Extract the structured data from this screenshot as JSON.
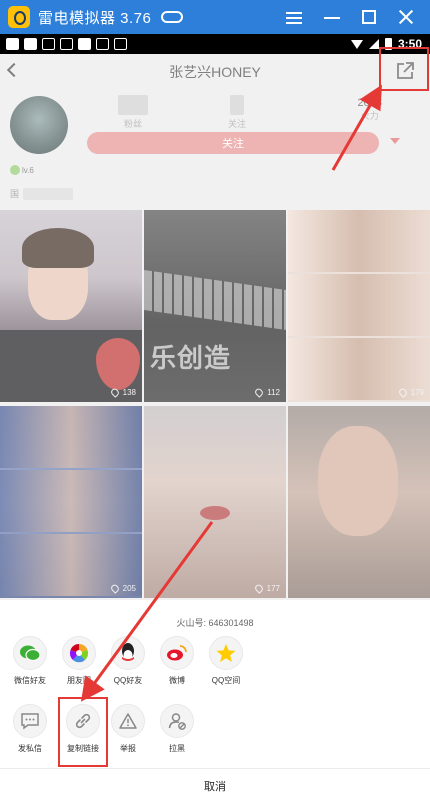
{
  "emulator": {
    "title": "雷电模拟器 3.76"
  },
  "status_bar": {
    "time": "3:50"
  },
  "header": {
    "title": "张艺兴HONEY"
  },
  "profile": {
    "stats": [
      {
        "label": "粉丝"
      },
      {
        "label": "关注"
      },
      {
        "value": "2018",
        "label": "火力"
      }
    ],
    "follow_label": "关注",
    "level": "lv.6",
    "bio_prefix": "国"
  },
  "grid": {
    "tiles": [
      {
        "likes": "138",
        "overlay": ""
      },
      {
        "likes": "112",
        "overlay": "乐创造"
      },
      {
        "likes": "179",
        "overlay": ""
      },
      {
        "likes": "205",
        "overlay": ""
      },
      {
        "likes": "177",
        "overlay": ""
      },
      {
        "likes": "",
        "overlay": ""
      }
    ]
  },
  "share_sheet": {
    "account_id": "火山号: 646301498",
    "row1": [
      {
        "label": "微信好友",
        "icon": "wechat-icon"
      },
      {
        "label": "朋友圈",
        "icon": "moments-icon"
      },
      {
        "label": "QQ好友",
        "icon": "qq-icon"
      },
      {
        "label": "微博",
        "icon": "weibo-icon"
      },
      {
        "label": "QQ空间",
        "icon": "qzone-icon"
      }
    ],
    "row2": [
      {
        "label": "发私信",
        "icon": "message-icon"
      },
      {
        "label": "复制链接",
        "icon": "link-icon"
      },
      {
        "label": "举报",
        "icon": "report-icon"
      },
      {
        "label": "拉黑",
        "icon": "block-user-icon"
      }
    ],
    "cancel_label": "取消"
  },
  "colors": {
    "emulator_bar": "#2e7fd9",
    "follow_button": "#e89a9a",
    "annotation_red": "#e53935"
  }
}
